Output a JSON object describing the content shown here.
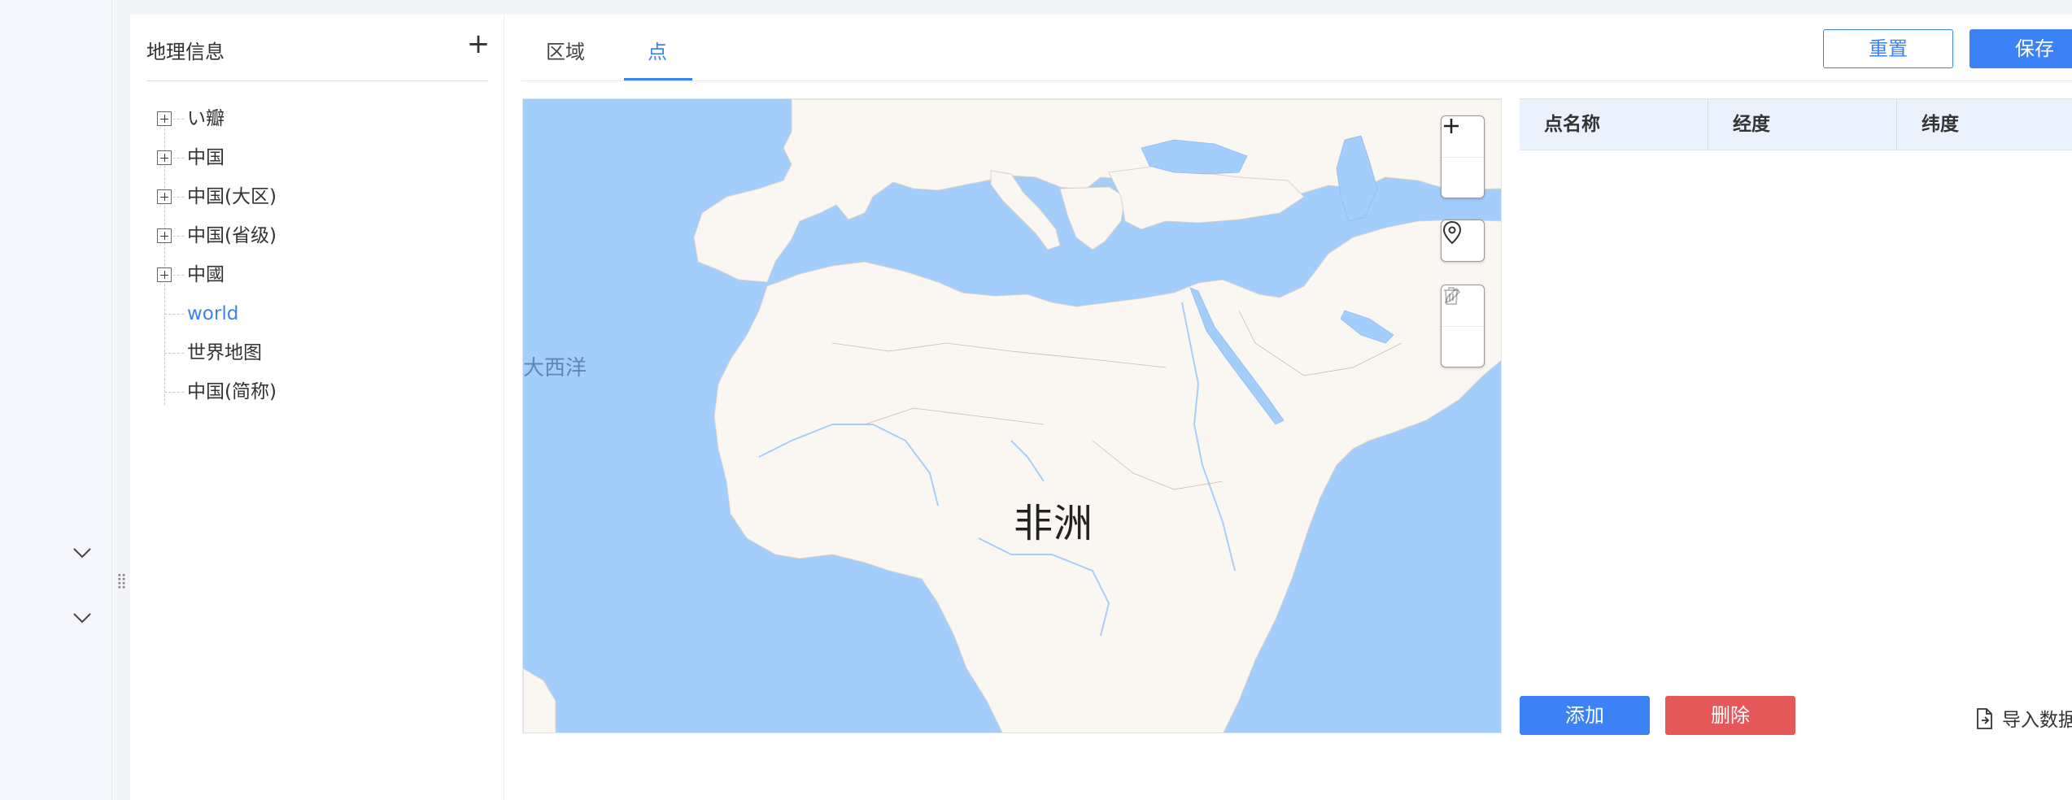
{
  "tree": {
    "title": "地理信息",
    "add_label": "+",
    "nodes": [
      {
        "label": "い瓣",
        "expandable": true
      },
      {
        "label": "中国",
        "expandable": true
      },
      {
        "label": "中国(大区)",
        "expandable": true
      },
      {
        "label": "中国(省级)",
        "expandable": true
      },
      {
        "label": "中國",
        "expandable": true
      },
      {
        "label": "world",
        "expandable": false,
        "active": true
      },
      {
        "label": "世界地图",
        "expandable": false
      },
      {
        "label": "中国(简称)",
        "expandable": false
      }
    ]
  },
  "tabs": [
    {
      "label": "区域",
      "active": false
    },
    {
      "label": "点",
      "active": true
    }
  ],
  "toolbar": {
    "reset_label": "重置",
    "save_label": "保存"
  },
  "map": {
    "ocean_label": "大西洋",
    "continent_label": "非洲",
    "controls": [
      "zoom-in",
      "zoom-out",
      "locate-point",
      "edit",
      "delete"
    ]
  },
  "table": {
    "columns": [
      "点名称",
      "经度",
      "纬度"
    ],
    "rows": []
  },
  "actions": {
    "add_label": "添加",
    "delete_label": "删除",
    "import_label": "导入数据"
  },
  "colors": {
    "primary": "#3c82f6",
    "danger": "#e5585a",
    "water": "#a3cdfb",
    "land": "#faf7f2",
    "header_bg": "#e9f2fd"
  }
}
